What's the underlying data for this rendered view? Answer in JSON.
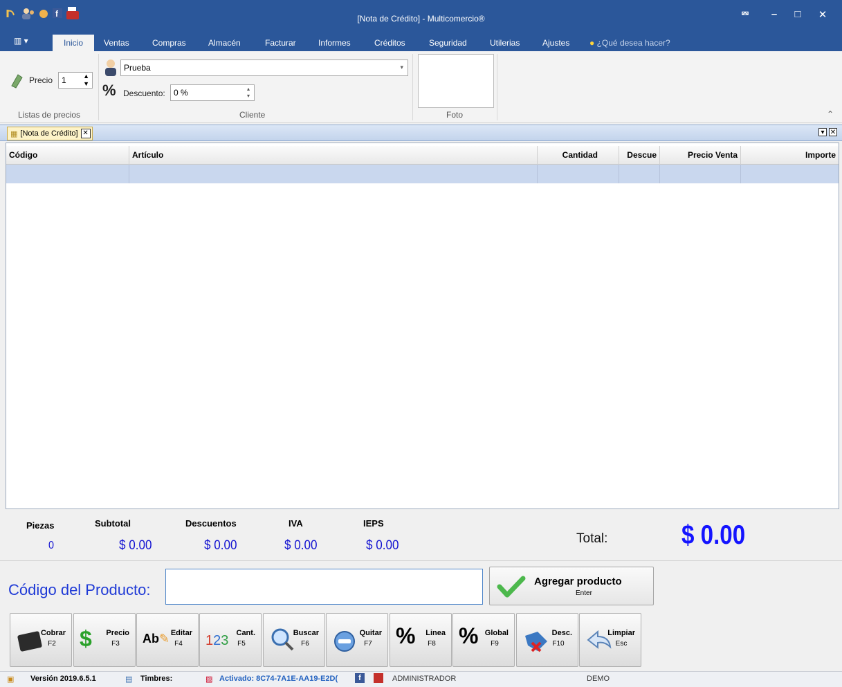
{
  "window": {
    "title": "[Nota de Crédito] - Multicomercio®",
    "min_icon": "minimize-icon",
    "max_icon": "maximize-icon",
    "close_icon": "close-icon"
  },
  "ribbon": {
    "tabs": [
      "Inicio",
      "Ventas",
      "Compras",
      "Almacén",
      "Facturar",
      "Informes",
      "Créditos",
      "Seguridad",
      "Utilerias",
      "Ajustes"
    ],
    "tell_me": "¿Qué desea hacer?",
    "precio_label": "Precio",
    "precio_value": "1",
    "price_group_label": "Listas de precios",
    "cliente_value": "Prueba",
    "descuento_label": "Descuento:",
    "descuento_value": "0 %",
    "cliente_group_label": "Cliente",
    "foto_group_label": "Foto"
  },
  "document_tab": {
    "label": "[Nota de Crédito]"
  },
  "grid": {
    "columns": [
      "Código",
      "Artículo",
      "Cantidad",
      "Descue",
      "Precio Venta",
      "Importe"
    ]
  },
  "totals": {
    "piezas_label": "Piezas",
    "piezas_value": "0",
    "subtotal_label": "Subtotal",
    "subtotal_value": "$ 0.00",
    "descuentos_label": "Descuentos",
    "descuentos_value": "$ 0.00",
    "iva_label": "IVA",
    "iva_value": "$ 0.00",
    "ieps_label": "IEPS",
    "ieps_value": "$ 0.00",
    "total_label": "Total:",
    "total_value": "$ 0.00"
  },
  "entry": {
    "product_label": "Código del Producto:",
    "product_value": "",
    "add_label": "Agregar producto",
    "add_key": "Enter"
  },
  "buttons": [
    {
      "label": "Cobrar",
      "key": "F2"
    },
    {
      "label": "Precio",
      "key": "F3"
    },
    {
      "label": "Editar",
      "key": "F4"
    },
    {
      "label": "Cant.",
      "key": "F5"
    },
    {
      "label": "Buscar",
      "key": "F6"
    },
    {
      "label": "Quitar",
      "key": "F7"
    },
    {
      "label": "Linea",
      "key": "F8"
    },
    {
      "label": "Global",
      "key": "F9"
    },
    {
      "label": "Desc.",
      "key": "F10"
    },
    {
      "label": "Limpiar",
      "key": "Esc"
    }
  ],
  "status": {
    "version": "Versión 2019.6.5.1",
    "timbres": "Timbres:",
    "activado": "Activado: 8C74-7A1E-AA19-E2D(",
    "user": "ADMINISTRADOR",
    "mode": "DEMO"
  },
  "colors": {
    "title_blue": "#2b579a",
    "amount_blue": "#1414d2",
    "total_blue": "#1414ff"
  }
}
